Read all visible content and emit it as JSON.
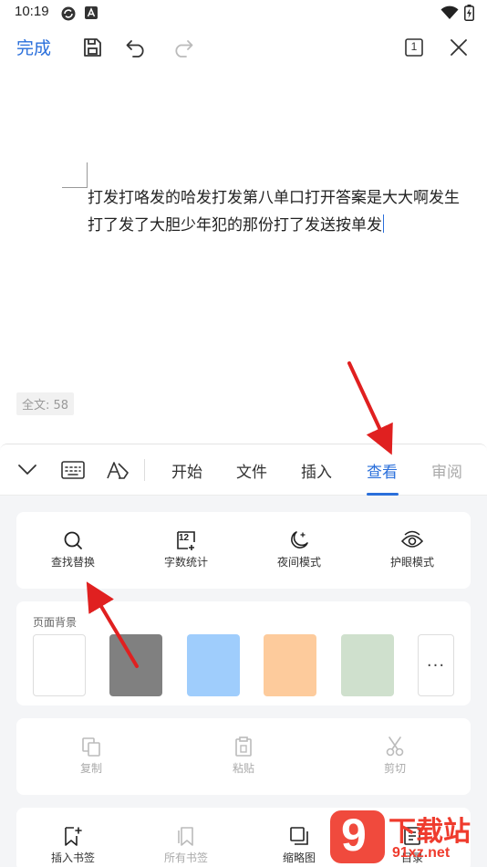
{
  "status_bar": {
    "time": "10:19"
  },
  "toolbar": {
    "done_label": "完成",
    "page_indicator": "1"
  },
  "document": {
    "line1": "打发打咯发的哈发打发第八单口打开答案是大大啊发生",
    "line2": "打了发了大胆少年犯的那份打了发送按单发",
    "word_count": "全文: 58"
  },
  "tabs": {
    "items": [
      "开始",
      "文件",
      "插入",
      "查看",
      "审阅"
    ],
    "active": "查看"
  },
  "view_tools": {
    "find_replace": "查找替换",
    "word_stats": "字数统计",
    "night_mode": "夜间模式",
    "eye_care": "护眼模式",
    "word_stats_icon_number": "12"
  },
  "page_background": {
    "title": "页面背景",
    "swatches": [
      "#ffffff",
      "#808080",
      "#9fcdfc",
      "#fdcb9c",
      "#cfe0cd"
    ],
    "more": "···"
  },
  "edit_tools": {
    "copy": "复制",
    "paste": "粘贴",
    "cut": "剪切"
  },
  "bookmark_tools": {
    "insert_bookmark": "插入书签",
    "all_bookmarks": "所有书签",
    "thumbnail": "缩略图",
    "toc": "目录"
  },
  "watermark": {
    "brand_digit": "9",
    "brand_text": "下载站",
    "domain": "91xz.net"
  },
  "colors": {
    "accent": "#2a6fdb",
    "arrow": "#e02020"
  }
}
